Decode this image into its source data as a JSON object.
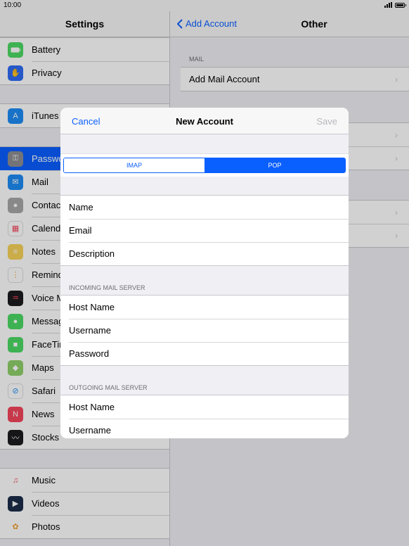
{
  "status_bar": {
    "time": "10:00"
  },
  "left_pane": {
    "title": "Settings",
    "groups": [
      [
        {
          "label": "Battery",
          "icon": "battery-icon",
          "color": "#4cd964"
        },
        {
          "label": "Privacy",
          "icon": "hand-icon",
          "color": "#2f6cf5"
        }
      ],
      [
        {
          "label": "iTunes",
          "icon": "app-store-icon",
          "color": "#1e8df5"
        }
      ],
      [
        {
          "label": "Passwo",
          "icon": "key-icon",
          "color": "#8e8e93",
          "selected": true
        },
        {
          "label": "Mail",
          "icon": "mail-icon",
          "color": "#1e8df5"
        },
        {
          "label": "Contac",
          "icon": "contacts-icon",
          "color": "#9b9b9b"
        },
        {
          "label": "Calend",
          "icon": "calendar-icon",
          "color": "#ffffff"
        },
        {
          "label": "Notes",
          "icon": "notes-icon",
          "color": "#f7d25a"
        },
        {
          "label": "Remind",
          "icon": "reminders-icon",
          "color": "#ffffff"
        },
        {
          "label": "Voice M",
          "icon": "voice-memos-icon",
          "color": "#1c1c1e"
        },
        {
          "label": "Messag",
          "icon": "messages-icon",
          "color": "#4cd964"
        },
        {
          "label": "FaceTim",
          "icon": "facetime-icon",
          "color": "#4cd964"
        },
        {
          "label": "Maps",
          "icon": "maps-icon",
          "color": "#8fd16b"
        },
        {
          "label": "Safari",
          "icon": "safari-icon",
          "color": "#ffffff"
        },
        {
          "label": "News",
          "icon": "news-icon",
          "color": "#f5455c"
        },
        {
          "label": "Stocks",
          "icon": "stocks-icon",
          "color": "#1c1c1e"
        }
      ],
      [
        {
          "label": "Music",
          "icon": "music-icon",
          "color": "#ffffff"
        },
        {
          "label": "Videos",
          "icon": "videos-icon",
          "color": "#1c2c4a"
        },
        {
          "label": "Photos",
          "icon": "photos-icon",
          "color": "#ffffff"
        }
      ]
    ]
  },
  "right_pane": {
    "back_label": "Add Account",
    "title": "Other",
    "mail_section_label": "MAIL",
    "add_mail_account": "Add Mail Account"
  },
  "modal": {
    "cancel": "Cancel",
    "title": "New Account",
    "save": "Save",
    "segments": [
      "IMAP",
      "POP"
    ],
    "selected_segment": "POP",
    "account_fields": [
      "Name",
      "Email",
      "Description"
    ],
    "incoming_label": "INCOMING MAIL SERVER",
    "incoming_fields": [
      "Host Name",
      "Username",
      "Password"
    ],
    "outgoing_label": "OUTGOING MAIL SERVER",
    "outgoing_fields": [
      "Host Name",
      "Username"
    ]
  },
  "colors": {
    "accent": "#0a5fff",
    "chevron": "#c7c7cc"
  }
}
